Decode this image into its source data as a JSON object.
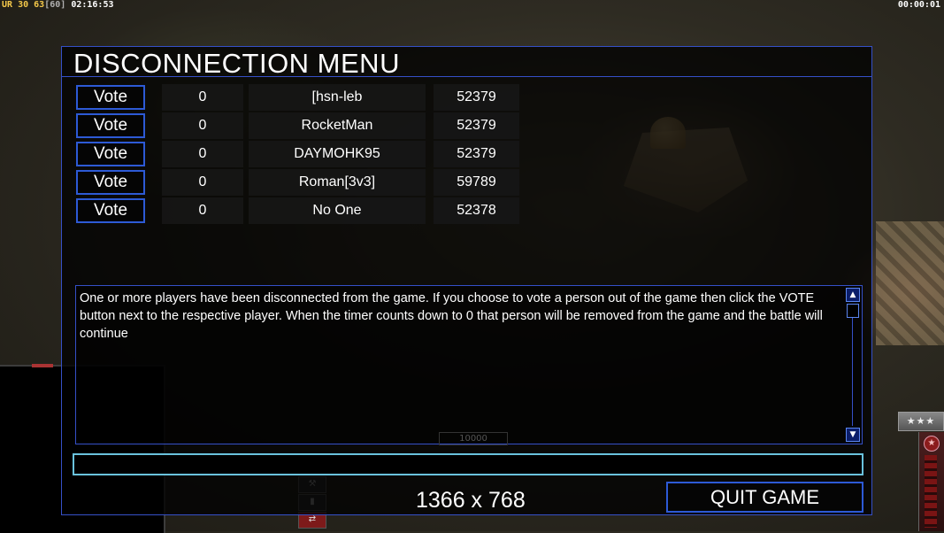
{
  "hud": {
    "ur_label": "UR",
    "fps_value": "30",
    "fps_other": "63",
    "fps_cap": "[60]",
    "game_time": "02:16:53",
    "timer_right": "00:00:01"
  },
  "dialog": {
    "title": "DISCONNECTION MENU",
    "vote_label": "Vote",
    "players": [
      {
        "votes": "0",
        "name": "[hsn-leb",
        "ping": "52379"
      },
      {
        "votes": "0",
        "name": "RocketMan",
        "ping": "52379"
      },
      {
        "votes": "0",
        "name": "DAYMOHK95",
        "ping": "52379"
      },
      {
        "votes": "0",
        "name": "Roman[3v3]",
        "ping": "59789"
      },
      {
        "votes": "0",
        "name": "No One",
        "ping": "52378"
      }
    ],
    "message": "One or more players have been disconnected from the game. If you choose to vote a person out of the game then click the VOTE button next to the respective player. When the timer counts down to 0 that person will be removed from the game and the battle will continue",
    "chat_value": "",
    "quit_label": "QUIT GAME",
    "ghost_value": "10000"
  },
  "overlay": {
    "resolution": "1366 x 768"
  },
  "game_ui": {
    "rank_stars": "★★★",
    "badge_star": "★"
  },
  "colors": {
    "dialog_border": "#3550c8",
    "vote_border": "#2d5ad6",
    "chat_border": "#6ac2dc",
    "hud_yellow": "#f4c84a"
  }
}
